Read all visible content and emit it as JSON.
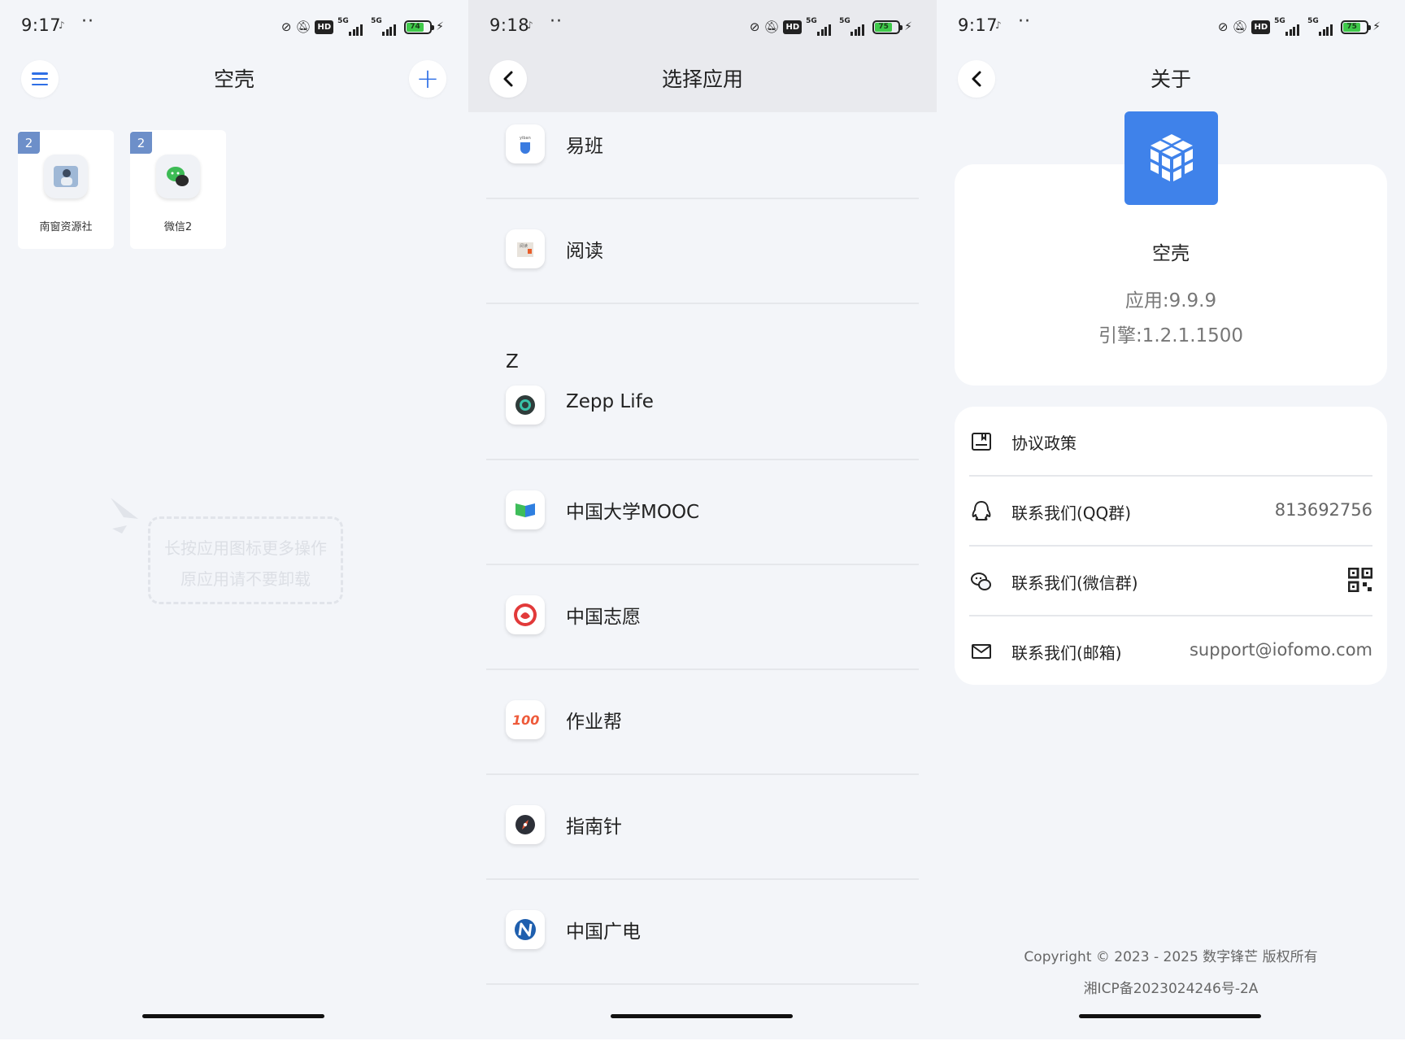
{
  "panel1": {
    "status": {
      "time": "9:17",
      "battery": "74"
    },
    "header": {
      "title": "空壳"
    },
    "apps": [
      {
        "label": "南窗资源社",
        "badge": "2"
      },
      {
        "label": "微信2",
        "badge": "2"
      }
    ],
    "hint": {
      "line1": "长按应用图标更多操作",
      "line2": "原应用请不要卸载"
    }
  },
  "panel2": {
    "status": {
      "time": "9:18",
      "battery": "75"
    },
    "header": {
      "title": "选择应用"
    },
    "section_z": "Z",
    "items": [
      {
        "name": "易班"
      },
      {
        "name": "阅读"
      },
      {
        "name": "Zepp Life"
      },
      {
        "name": "中国大学MOOC"
      },
      {
        "name": "中国志愿"
      },
      {
        "name": "作业帮"
      },
      {
        "name": "指南针"
      },
      {
        "name": "中国广电"
      }
    ]
  },
  "panel3": {
    "status": {
      "time": "9:17",
      "battery": "75"
    },
    "header": {
      "title": "关于"
    },
    "app_name": "空壳",
    "app_version": "应用:9.9.9",
    "engine_version": "引擎:1.2.1.1500",
    "rows": [
      {
        "label": "协议政策",
        "value": ""
      },
      {
        "label": "联系我们(QQ群)",
        "value": "813692756"
      },
      {
        "label": "联系我们(微信群)",
        "value": ""
      },
      {
        "label": "联系我们(邮箱)",
        "value": "support@iofomo.com"
      }
    ],
    "copyright": "Copyright © 2023 - 2025 数字锋芒 版权所有",
    "icp": "湘ICP备2023024246号-2A"
  },
  "status_common": {
    "network": "5G",
    "hd": "HD"
  },
  "colors": {
    "accent": "#2e6fe6",
    "logo": "#3f82ea",
    "battery": "#3fc94a"
  }
}
